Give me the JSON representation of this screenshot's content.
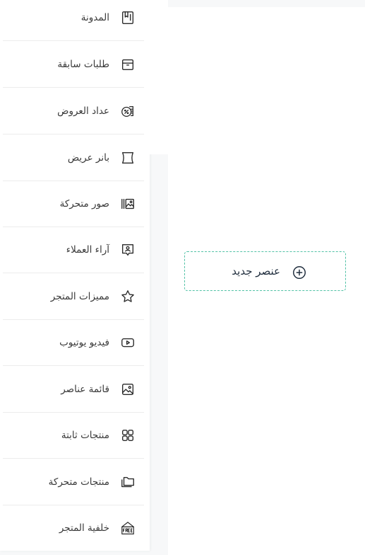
{
  "sidebar": {
    "items": [
      {
        "label": "المدونة",
        "icon": "blog-icon"
      },
      {
        "label": "طلبات سابقة",
        "icon": "box-icon"
      },
      {
        "label": "عداد العروض",
        "icon": "offer-counter-icon"
      },
      {
        "label": "بانر عريض",
        "icon": "wide-banner-icon"
      },
      {
        "label": "صور متحركة",
        "icon": "slider-images-icon"
      },
      {
        "label": "آراء العملاء",
        "icon": "testimonials-icon"
      },
      {
        "label": "مميزات المتجر",
        "icon": "star-icon"
      },
      {
        "label": "فيديو يوتيوب",
        "icon": "youtube-icon"
      },
      {
        "label": "قائمة عناصر",
        "icon": "image-list-icon"
      },
      {
        "label": "منتجات ثابتة",
        "icon": "grid-icon"
      },
      {
        "label": "منتجات متحركة",
        "icon": "folders-icon"
      },
      {
        "label": "خلفية المتجر",
        "icon": "free-store-icon"
      }
    ]
  },
  "main": {
    "add_label": "عنصر جديد"
  },
  "colors": {
    "accent_border": "#52c2a6",
    "icon_stroke": "#2b2b2b"
  }
}
